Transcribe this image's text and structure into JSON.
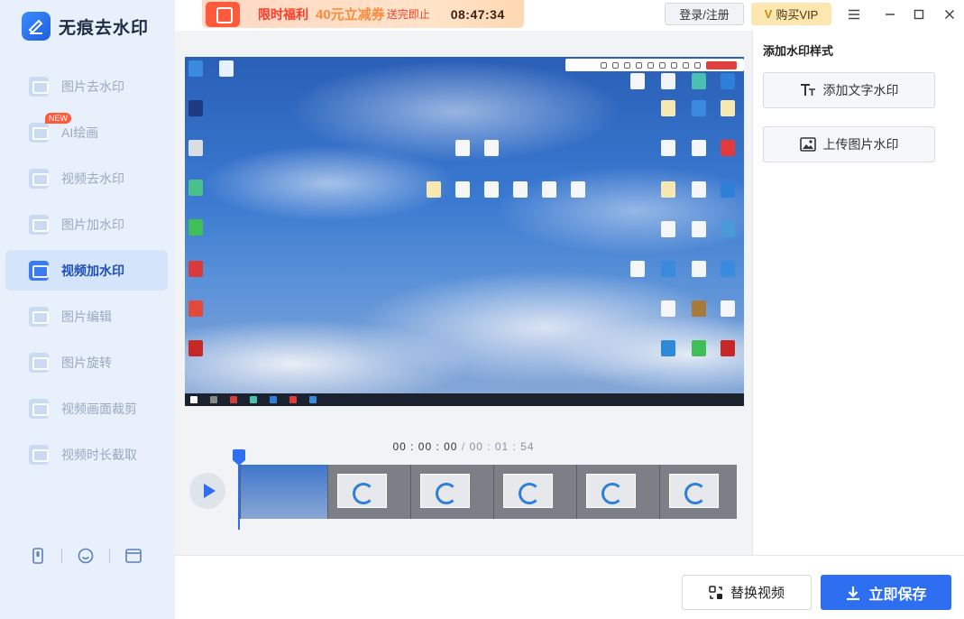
{
  "app": {
    "name": "无痕去水印",
    "logo_icon": "app-logo-icon"
  },
  "sidebar": {
    "items": [
      {
        "label": "图片去水印",
        "icon": "image-remove-watermark-icon",
        "active": false
      },
      {
        "label": "AI绘画",
        "icon": "ai-paint-icon",
        "active": false,
        "badge": "NEW"
      },
      {
        "label": "视频去水印",
        "icon": "video-remove-watermark-icon",
        "active": false
      },
      {
        "label": "图片加水印",
        "icon": "image-add-watermark-icon",
        "active": false
      },
      {
        "label": "视频加水印",
        "icon": "video-add-watermark-icon",
        "active": true
      },
      {
        "label": "图片编辑",
        "icon": "image-edit-icon",
        "active": false
      },
      {
        "label": "图片旋转",
        "icon": "image-rotate-icon",
        "active": false
      },
      {
        "label": "视频画面裁剪",
        "icon": "video-crop-icon",
        "active": false
      },
      {
        "label": "视频时长截取",
        "icon": "video-trim-icon",
        "active": false
      }
    ],
    "bottom_icons": [
      "phone-icon",
      "smiley-icon",
      "window-icon"
    ]
  },
  "topbar": {
    "promo": {
      "title": "限时福利",
      "amount": "40元立减券",
      "note": "送完即止",
      "timer": "08:47:34"
    },
    "login_label": "登录/注册",
    "vip_mark": "V",
    "vip_label": "购买VIP",
    "controls": [
      "menu-icon",
      "minimize-icon",
      "maximize-icon",
      "close-icon"
    ]
  },
  "player": {
    "current_time": "00 : 00 : 00",
    "separator": "/",
    "total_time": "00 : 01 : 54"
  },
  "panel": {
    "title": "添加水印样式",
    "add_text_label": "添加文字水印",
    "upload_image_label": "上传图片水印"
  },
  "footer": {
    "replace_label": "替换视频",
    "save_label": "立即保存"
  },
  "colors": {
    "accent": "#2d6ff0",
    "sidebar_bg": "#e8f0fb",
    "promo_red": "#ff3b28"
  }
}
